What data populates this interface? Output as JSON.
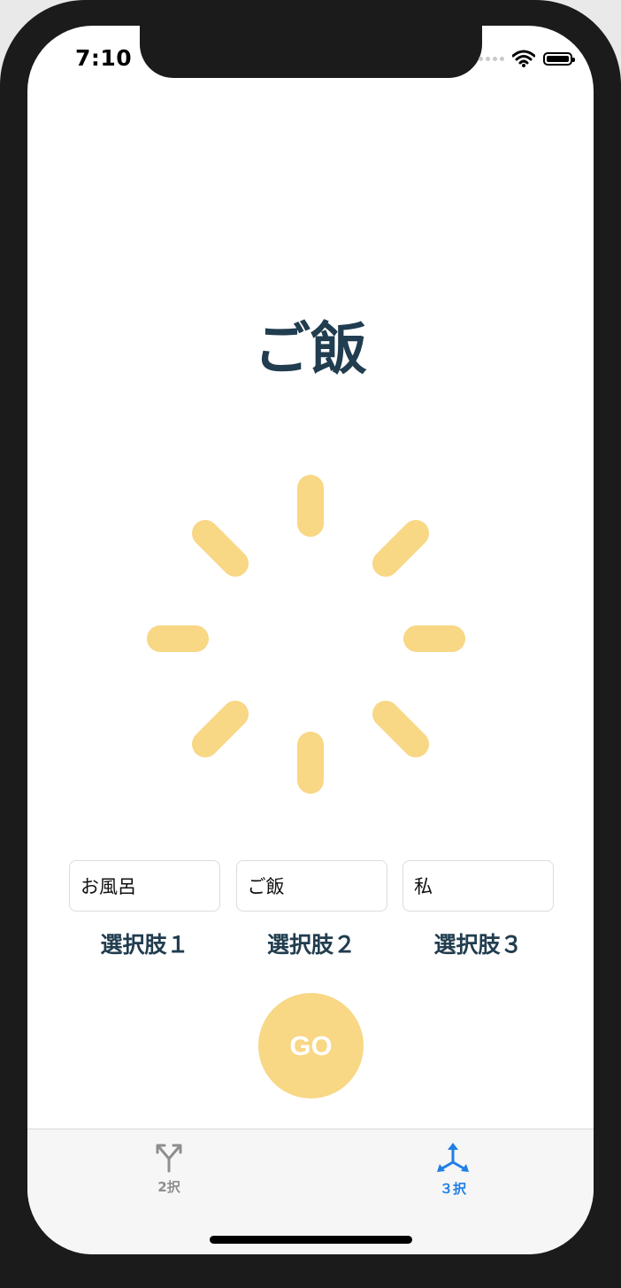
{
  "status_bar": {
    "time": "7:10"
  },
  "result": {
    "text": "ご飯"
  },
  "choices": [
    {
      "value": "お風呂",
      "label": "選択肢１"
    },
    {
      "value": "ご飯",
      "label": "選択肢２"
    },
    {
      "value": "私",
      "label": "選択肢３"
    }
  ],
  "go_button": {
    "label": "GO"
  },
  "tabs": [
    {
      "label": "2択",
      "icon": "two-way-branch-icon",
      "selected": false
    },
    {
      "label": "３択",
      "icon": "three-way-branch-icon",
      "selected": true
    }
  ],
  "colors": {
    "accent": "#f8d785",
    "text_dark": "#213d4f",
    "tab_selected": "#1f7fe6",
    "tab_unselected": "#8e8e8e"
  }
}
